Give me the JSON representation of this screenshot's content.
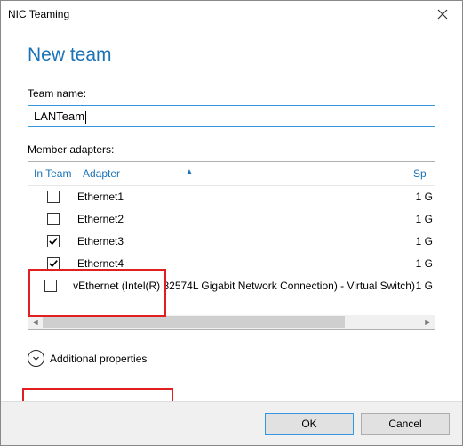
{
  "window": {
    "title": "NIC Teaming"
  },
  "heading": "New team",
  "team_name": {
    "label": "Team name:",
    "value": "LANTeam"
  },
  "members": {
    "label": "Member adapters:",
    "columns": {
      "in_team": "In Team",
      "adapter": "Adapter",
      "speed": "Sp"
    },
    "rows": [
      {
        "checked": false,
        "adapter": "Ethernet1",
        "speed": "1 G"
      },
      {
        "checked": false,
        "adapter": "Ethernet2",
        "speed": "1 G"
      },
      {
        "checked": true,
        "adapter": "Ethernet3",
        "speed": "1 G"
      },
      {
        "checked": true,
        "adapter": "Ethernet4",
        "speed": "1 G"
      },
      {
        "checked": false,
        "adapter": "vEthernet (Intel(R) 82574L Gigabit Network Connection) - Virtual Switch)",
        "speed": "1 G"
      }
    ]
  },
  "additional": {
    "label": "Additional properties"
  },
  "buttons": {
    "ok": "OK",
    "cancel": "Cancel"
  },
  "colors": {
    "accent": "#1a73b7",
    "highlight": "#e02020"
  }
}
